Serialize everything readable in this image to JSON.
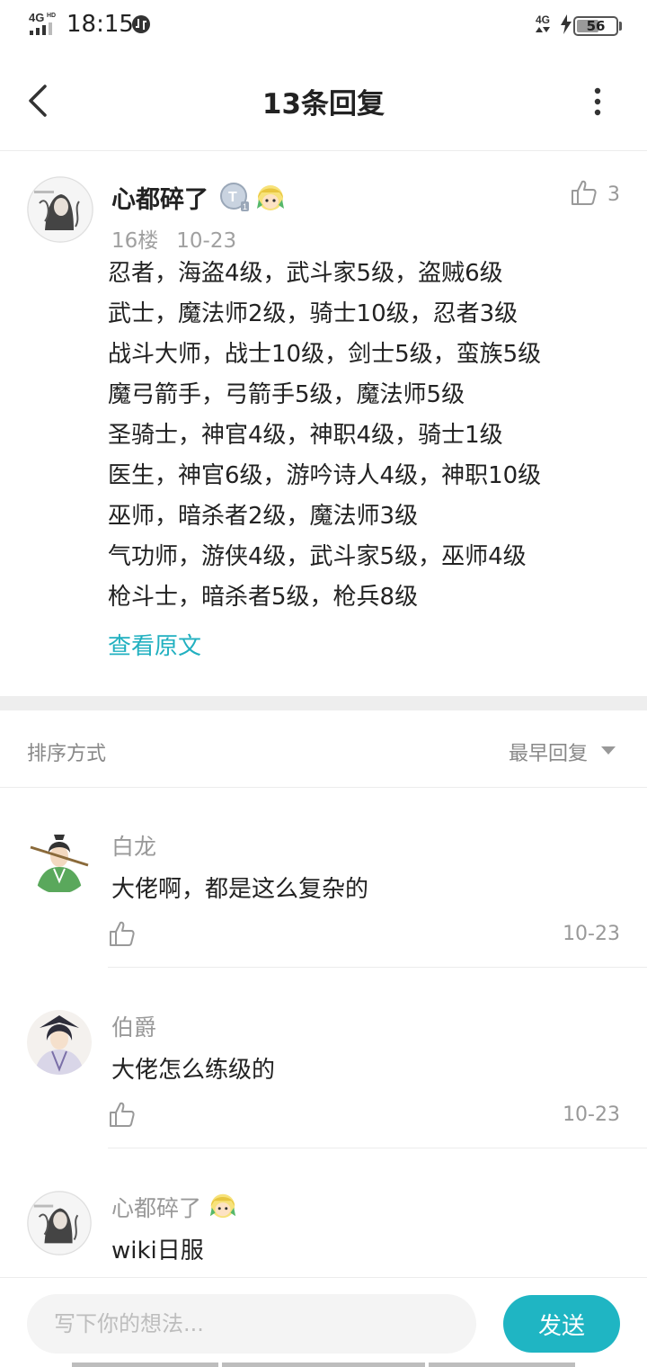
{
  "status_bar": {
    "network": "4G",
    "network_hd": "HD",
    "time": "18:15",
    "right_network": "4G",
    "battery": "56",
    "battery_level": 0.56
  },
  "header": {
    "title": "13条回复"
  },
  "post": {
    "author": "心都碎了",
    "floor": "16楼",
    "date": "10-23",
    "likes": "3",
    "lines": [
      "忍者，海盗4级，武斗家5级，盗贼6级",
      "武士，魔法师2级，骑士10级，忍者3级",
      "战斗大师，战士10级，剑士5级，蛮族5级",
      "魔弓箭手，弓箭手5级，魔法师5级",
      "圣骑士，神官4级，神职4级，骑士1级",
      "医生，神官6级，游吟诗人4级，神职10级",
      "巫师，暗杀者2级，魔法师3级",
      "气功师，游侠4级，武斗家5级，巫师4级",
      "枪斗士，暗杀者5级，枪兵8级"
    ],
    "view_original": "查看原文"
  },
  "sort": {
    "label": "排序方式",
    "value": "最早回复"
  },
  "replies": [
    {
      "name": "白龙",
      "text": "大佬啊，都是这么复杂的",
      "date": "10-23"
    },
    {
      "name": "伯爵",
      "text": "大佬怎么练级的",
      "date": "10-23"
    },
    {
      "name": "心都碎了",
      "text": "wiki日服",
      "date": ""
    }
  ],
  "composer": {
    "placeholder": "写下你的想法...",
    "send_label": "发送"
  },
  "colors": {
    "accent": "#1fb5c3",
    "link": "#21b0c0"
  }
}
